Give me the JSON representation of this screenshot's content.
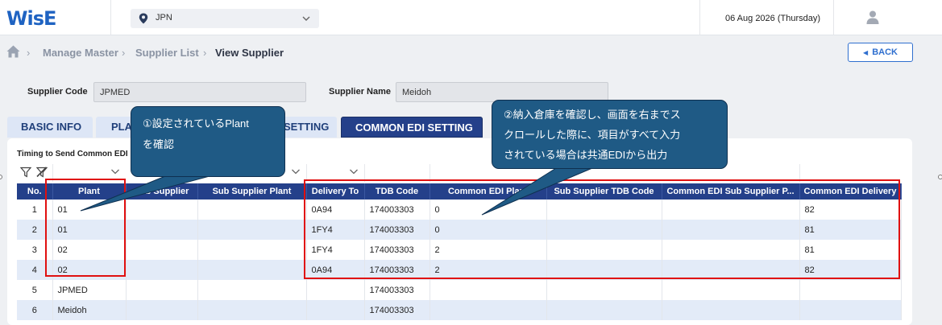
{
  "header": {
    "logo": "WisE",
    "country": "JPN",
    "date": "06 Aug 2026 (Thursday)"
  },
  "breadcrumb": [
    "Manage Master",
    "Supplier List",
    "View Supplier"
  ],
  "back_label": "BACK",
  "supplier": {
    "code_label": "Supplier Code",
    "code_value": "JPMED",
    "name_label": "Supplier Name",
    "name_value": "Meidoh"
  },
  "tabs": [
    "BASIC INFO",
    "PLA",
    "SETTING",
    "COMMON EDI SETTING"
  ],
  "timing_label": "Timing to Send Common EDI",
  "table": {
    "columns": [
      "No.",
      "Plant",
      "Sub Supplier",
      "Sub Supplier Plant",
      "Delivery To",
      "TDB Code",
      "Common EDI Plant",
      "Sub Supplier TDB Code",
      "Common EDI Sub Supplier P...",
      "Common EDI Delivery"
    ],
    "rows": [
      [
        "1",
        "01",
        "",
        "",
        "0A94",
        "174003303",
        "0",
        "",
        "",
        "82"
      ],
      [
        "2",
        "01",
        "",
        "",
        "1FY4",
        "174003303",
        "0",
        "",
        "",
        "81"
      ],
      [
        "3",
        "02",
        "",
        "",
        "1FY4",
        "174003303",
        "2",
        "",
        "",
        "81"
      ],
      [
        "4",
        "02",
        "",
        "",
        "0A94",
        "174003303",
        "2",
        "",
        "",
        "82"
      ],
      [
        "5",
        "JPMED",
        "",
        "",
        "",
        "174003303",
        "",
        "",
        "",
        ""
      ],
      [
        "6",
        "Meidoh",
        "",
        "",
        "",
        "174003303",
        "",
        "",
        "",
        ""
      ]
    ]
  },
  "callouts": {
    "left": [
      "①設定されているPlant",
      "を確認"
    ],
    "right": [
      "②納入倉庫を確認し、画面を右までス",
      "クロールした際に、項目がすべて入力",
      "されている場合は共通EDIから出力"
    ]
  },
  "colors": {
    "brand": "#1f63c2",
    "header_bg": "#24408a",
    "row_alt": "#e3ebf8",
    "callout": "#1f5a85",
    "highlight": "#e01010"
  }
}
